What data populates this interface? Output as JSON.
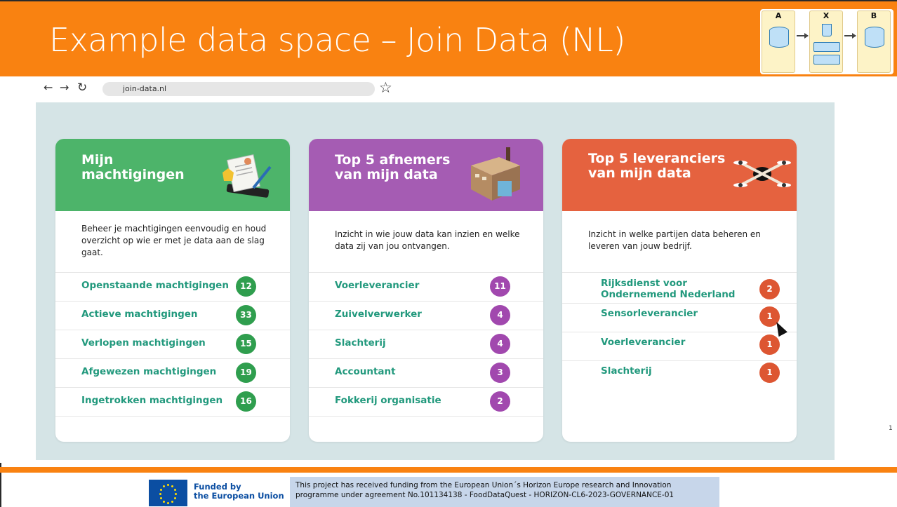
{
  "slide": {
    "title": "Example data space – Join Data (NL)",
    "page_number": "1",
    "diagram_labels": [
      "A",
      "X",
      "B"
    ]
  },
  "browser": {
    "back_icon": "arrow-left-icon",
    "forward_icon": "arrow-right-icon",
    "reload_icon": "reload-icon",
    "url": "join-data.nl",
    "bookmark_icon": "star-icon"
  },
  "cards": [
    {
      "title": "Mijn machtigingen",
      "icon": "document-signing-icon",
      "color": "#4db46a",
      "description": "Beheer je machtigingen eenvoudig en houd overzicht op wie er met je data aan de slag gaat.",
      "rows": [
        {
          "label": "Openstaande machtigingen",
          "count": "12"
        },
        {
          "label": "Actieve machtigingen",
          "count": "33"
        },
        {
          "label": "Verlopen machtigingen",
          "count": "15"
        },
        {
          "label": "Afgewezen machtigingen",
          "count": "19"
        },
        {
          "label": "Ingetrokken machtigingen",
          "count": "16"
        }
      ]
    },
    {
      "title": "Top 5 afnemers van mijn data",
      "icon": "factory-icon",
      "color": "#a55cb3",
      "description": "Inzicht in wie jouw data kan inzien en welke data zij van jou ontvangen.",
      "rows": [
        {
          "label": "Voerleverancier",
          "count": "11"
        },
        {
          "label": "Zuivelverwerker",
          "count": "4"
        },
        {
          "label": "Slachterij",
          "count": "4"
        },
        {
          "label": "Accountant",
          "count": "3"
        },
        {
          "label": "Fokkerij organisatie",
          "count": "2"
        }
      ]
    },
    {
      "title": "Top 5 leveranciers van mijn data",
      "icon": "drone-icon",
      "color": "#e5623f",
      "description": "Inzicht in welke partijen data beheren en leveren van jouw bedrijf.",
      "rows": [
        {
          "label": "Rijksdienst voor Ondernemend Nederland",
          "count": "2"
        },
        {
          "label": "Sensorleverancier",
          "count": "1"
        },
        {
          "label": "Voerleverancier",
          "count": "1"
        },
        {
          "label": "Slachterij",
          "count": "1"
        }
      ]
    }
  ],
  "footer": {
    "funded_line1": "Funded by",
    "funded_line2": "the European Union",
    "funding_line1": "This project has received funding from the  European Union´s Horizon Europe research and Innovation",
    "funding_line2": "programme under agreement No.101134138 - FoodDataQuest - HORIZON-CL6-2023-GOVERNANCE-01"
  }
}
